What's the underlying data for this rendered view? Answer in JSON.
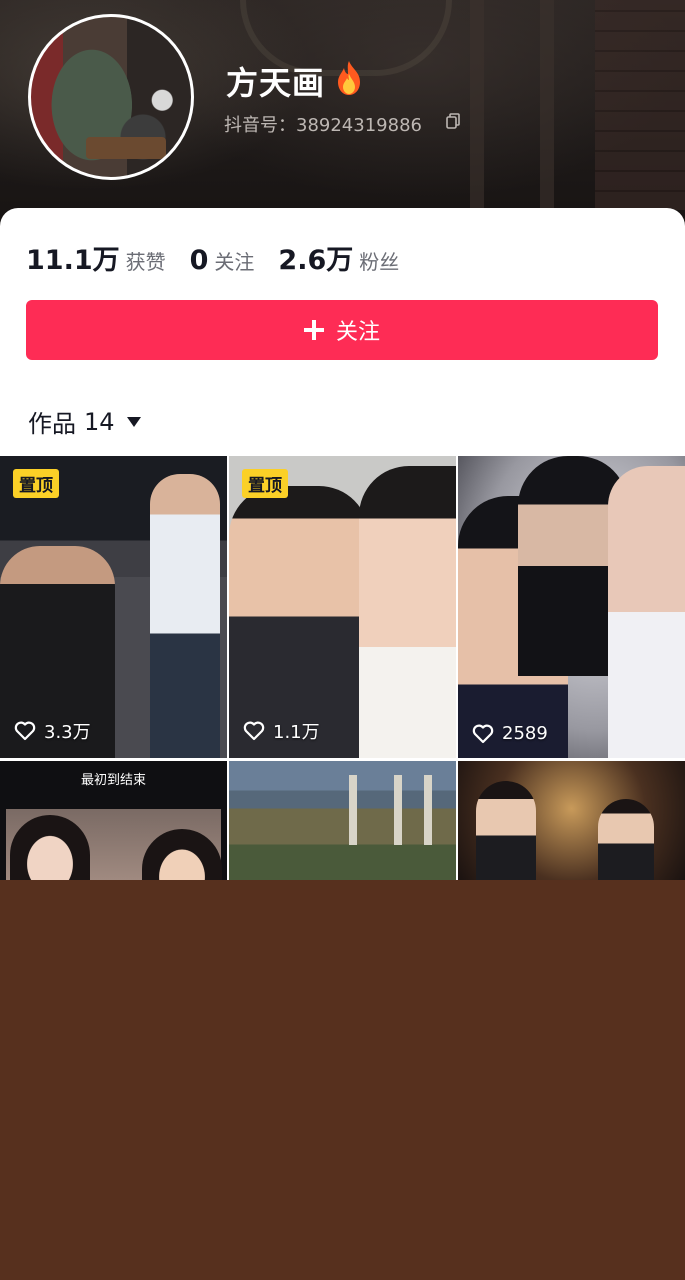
{
  "profile": {
    "name": "方天画",
    "douyin_id": "抖音号：38924319886"
  },
  "stats": [
    {
      "value": "11.1万",
      "label": "获赞"
    },
    {
      "value": "0",
      "label": "关注"
    },
    {
      "value": "2.6万",
      "label": "粉丝"
    }
  ],
  "follow_button": {
    "label": "关注"
  },
  "works_tab": {
    "label": "作品",
    "count": "14"
  },
  "videos": [
    {
      "pinned": "置顶",
      "likes": "3.3万"
    },
    {
      "pinned": "置顶",
      "likes": "1.1万"
    },
    {
      "likes": "2589"
    },
    {
      "caption": "最初到结束"
    },
    {},
    {}
  ],
  "colors": {
    "accent": "#fe2c55",
    "pin_badge": "#fbd027",
    "page_bg": "#57301e"
  },
  "icons": [
    "fire-icon",
    "copy-icon",
    "plus-icon",
    "caret-down-icon",
    "heart-icon"
  ]
}
